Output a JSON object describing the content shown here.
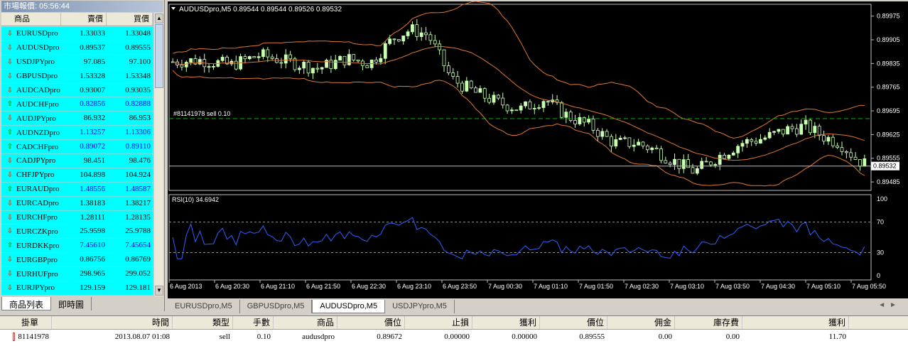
{
  "market_watch": {
    "title": "市場報價: 05:56:44",
    "headers": {
      "symbol": "商品",
      "bid": "賣價",
      "ask": "買價"
    },
    "rows": [
      {
        "symbol": "EURUSDpro",
        "bid": "1.33033",
        "ask": "1.33048",
        "dir": "down",
        "blue": false
      },
      {
        "symbol": "AUDUSDpro",
        "bid": "0.89537",
        "ask": "0.89555",
        "dir": "down",
        "blue": false
      },
      {
        "symbol": "USDJPYpro",
        "bid": "97.085",
        "ask": "97.100",
        "dir": "down",
        "blue": false
      },
      {
        "symbol": "GBPUSDpro",
        "bid": "1.53328",
        "ask": "1.53348",
        "dir": "down",
        "blue": false
      },
      {
        "symbol": "AUDCADpro",
        "bid": "0.93007",
        "ask": "0.93035",
        "dir": "down",
        "blue": false
      },
      {
        "symbol": "AUDCHFpro",
        "bid": "0.82856",
        "ask": "0.82888",
        "dir": "up",
        "blue": true
      },
      {
        "symbol": "AUDJPYpro",
        "bid": "86.932",
        "ask": "86.953",
        "dir": "down",
        "blue": false
      },
      {
        "symbol": "AUDNZDpro",
        "bid": "1.13257",
        "ask": "1.13306",
        "dir": "up",
        "blue": true
      },
      {
        "symbol": "CADCHFpro",
        "bid": "0.89072",
        "ask": "0.89110",
        "dir": "up",
        "blue": true
      },
      {
        "symbol": "CADJPYpro",
        "bid": "98.451",
        "ask": "98.476",
        "dir": "down",
        "blue": false
      },
      {
        "symbol": "CHFJPYpro",
        "bid": "104.898",
        "ask": "104.924",
        "dir": "down",
        "blue": false
      },
      {
        "symbol": "EURAUDpro",
        "bid": "1.48556",
        "ask": "1.48587",
        "dir": "up",
        "blue": true
      },
      {
        "symbol": "EURCADpro",
        "bid": "1.38183",
        "ask": "1.38217",
        "dir": "down",
        "blue": false
      },
      {
        "symbol": "EURCHFpro",
        "bid": "1.28111",
        "ask": "1.28135",
        "dir": "down",
        "blue": false
      },
      {
        "symbol": "EURCZKpro",
        "bid": "25.9598",
        "ask": "25.9788",
        "dir": "down",
        "blue": false
      },
      {
        "symbol": "EURDKKpro",
        "bid": "7.45610",
        "ask": "7.45654",
        "dir": "up",
        "blue": true
      },
      {
        "symbol": "EURGBPpro",
        "bid": "0.86756",
        "ask": "0.86769",
        "dir": "down",
        "blue": false
      },
      {
        "symbol": "EURHUFpro",
        "bid": "298.965",
        "ask": "299.052",
        "dir": "down",
        "blue": false
      },
      {
        "symbol": "EURJPYpro",
        "bid": "129.159",
        "ask": "129.181",
        "dir": "down",
        "blue": false
      }
    ],
    "tabs": [
      "商品列表",
      "即時圖"
    ]
  },
  "chart": {
    "header": "AUDUSDpro,M5  0.89544 0.89544 0.89526 0.89532",
    "order_line_label": "#81141978 sell 0.10",
    "order_price": 0.89672,
    "current_price": 0.89532,
    "current_price_label": "0.89532",
    "price_axis": [
      "0.89975",
      "0.89905",
      "0.89835",
      "0.89765",
      "0.89695",
      "0.89625",
      "0.89555",
      "0.89485"
    ],
    "rsi_label": "RSI(10) 34.6942",
    "rsi_axis": [
      "100",
      "70",
      "30",
      "0"
    ],
    "time_axis": [
      "6 Aug 2013",
      "6 Aug 20:30",
      "6 Aug 21:10",
      "6 Aug 21:50",
      "6 Aug 22:30",
      "6 Aug 23:10",
      "6 Aug 23:50",
      "7 Aug 00:30",
      "7 Aug 01:10",
      "7 Aug 01:50",
      "7 Aug 02:30",
      "7 Aug 03:10",
      "7 Aug 03:50",
      "7 Aug 04:30",
      "7 Aug 05:10",
      "7 Aug 05:50"
    ],
    "colors": {
      "bull": "#c8ffb0",
      "bear": "#ffffff",
      "bands": "#e07830",
      "rsi": "#3060ff",
      "order_line": "#00c000"
    }
  },
  "chart_tabs": [
    "EURUSDpro,M5",
    "GBPUSDpro,M5",
    "AUDUSDpro,M5",
    "USDJPYpro,M5"
  ],
  "chart_tab_active": 2,
  "terminal": {
    "headers": [
      "掛單",
      "時間",
      "類型",
      "手數",
      "商品",
      "價位",
      "止損",
      "獲利",
      "價位",
      "佣金",
      "庫存費",
      "獲利"
    ],
    "row": {
      "ticket": "81141978",
      "time": "2013.08.07 01:08",
      "type": "sell",
      "lots": "0.10",
      "symbol": "audusdpro",
      "open_price": "0.89672",
      "sl": "0.00000",
      "tp": "0.00000",
      "price": "0.89555",
      "commission": "0.00",
      "swap": "0.00",
      "profit": "11.70"
    }
  }
}
